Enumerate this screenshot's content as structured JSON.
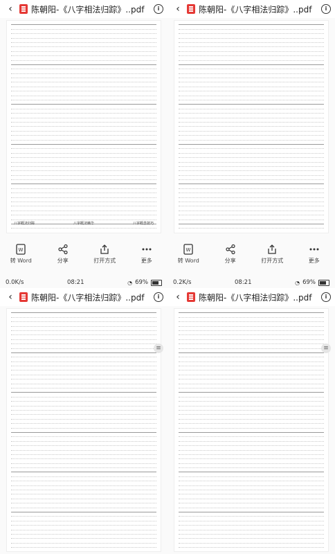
{
  "panels": [
    {
      "title": "陈朝阳-《八字相法归踪》..pdf",
      "actions": [
        {
          "label": "转 Word"
        },
        {
          "label": "分享"
        },
        {
          "label": "打开方式"
        },
        {
          "label": "更多"
        }
      ],
      "footer": [
        "八字概法归踪",
        "八字概法精华",
        "八字概念技巧"
      ]
    },
    {
      "title": "陈朝阳-《八字相法归踪》..pdf",
      "actions": [
        {
          "label": "转 Word"
        },
        {
          "label": "分享"
        },
        {
          "label": "打开方式"
        },
        {
          "label": "更多"
        }
      ],
      "footer": []
    },
    {
      "status": {
        "left": "0.0K/s",
        "time": "08:21",
        "battery": "69%"
      },
      "title": "陈朝阳-《八字相法归踪》..pdf",
      "footer": []
    },
    {
      "status": {
        "left": "0.2K/s",
        "time": "08:21",
        "battery": "69%"
      },
      "title": "陈朝阳-《八字相法归踪》..pdf",
      "footer": []
    }
  ],
  "icons": {
    "back": "back-arrow-icon",
    "pdf": "pdf-file-icon",
    "info": "info-icon",
    "word": "word-convert-icon",
    "share": "share-icon",
    "open": "open-with-icon",
    "more": "more-dots-icon"
  }
}
